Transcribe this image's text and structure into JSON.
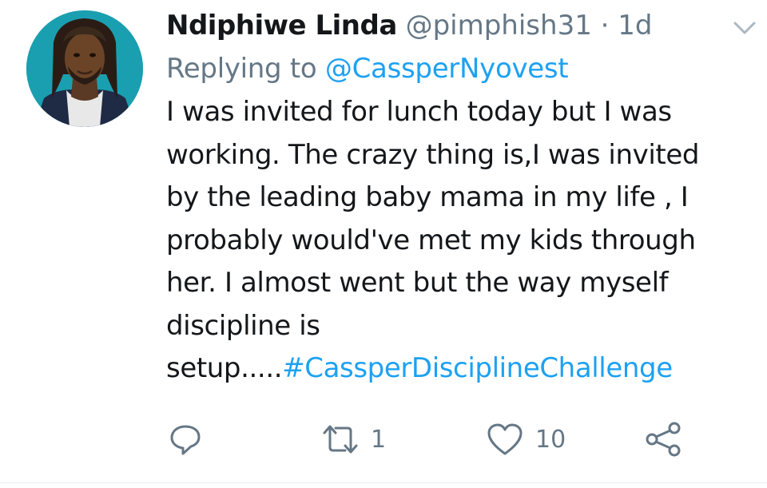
{
  "tweet": {
    "display_name": "Ndiphiwe Linda",
    "handle": "@pimphish31",
    "separator": "·",
    "time": "1d",
    "replying_prefix": "Replying to",
    "replying_to": "@CassperNyovest",
    "body_lines": [
      "I was invited for lunch today but I was",
      "working. The crazy thing is,I was invited",
      "by the leading baby mama in my life , I",
      "probably would've met my kids through",
      "her. I almost went but the way myself",
      "discipline is"
    ],
    "body_last_prefix": "setup.....",
    "hashtag": "#CassperDisciplineChallenge"
  },
  "actions": {
    "reply_icon": "reply-icon",
    "retweet_icon": "retweet-icon",
    "retweet_count": "1",
    "like_icon": "heart-icon",
    "like_count": "10",
    "share_icon": "share-icon"
  },
  "colors": {
    "link": "#1da1f2",
    "muted": "#657786",
    "text": "#14171a",
    "avatar_bg": "#1a9fb0"
  }
}
